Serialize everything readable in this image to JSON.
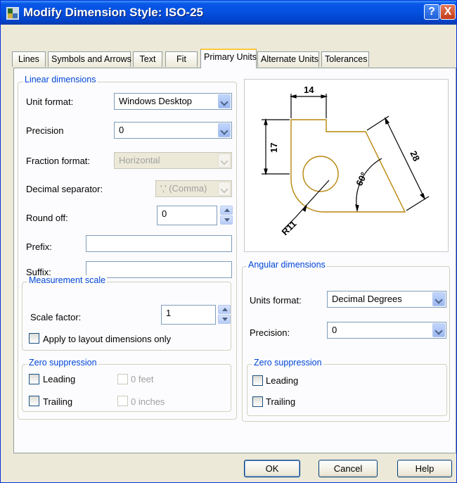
{
  "window": {
    "title": "Modify Dimension Style: ISO-25"
  },
  "titlebar": {
    "help": "?",
    "close": "X"
  },
  "tabs": [
    {
      "label": "Lines"
    },
    {
      "label": "Symbols and Arrows"
    },
    {
      "label": "Text"
    },
    {
      "label": "Fit"
    },
    {
      "label": "Primary Units"
    },
    {
      "label": "Alternate Units"
    },
    {
      "label": "Tolerances"
    }
  ],
  "linear": {
    "title": "Linear dimensions",
    "unit_format": {
      "label": "Unit format:",
      "value": "Windows Desktop"
    },
    "precision": {
      "label": "Precision",
      "value": "0"
    },
    "fraction_format": {
      "label": "Fraction format:",
      "value": "Horizontal"
    },
    "decimal_separator": {
      "label": "Decimal separator:",
      "value": "',' (Comma)"
    },
    "round_off": {
      "label": "Round off:",
      "value": "0"
    },
    "prefix": {
      "label": "Prefix:",
      "value": ""
    },
    "suffix": {
      "label": "Suffix:",
      "value": ""
    }
  },
  "measurement": {
    "title": "Measurement scale",
    "scale_factor": {
      "label": "Scale factor:",
      "value": "1"
    },
    "apply_layout": {
      "label": "Apply to layout dimensions only",
      "checked": false
    }
  },
  "zero_left": {
    "title": "Zero suppression",
    "leading": "Leading",
    "trailing": "Trailing",
    "feet": "0 feet",
    "inches": "0 inches"
  },
  "preview": {
    "dim_top": "14",
    "dim_left": "17",
    "dim_right": "28",
    "dim_angle": "60°",
    "dim_radius": "R11",
    "colors": {
      "geometry": "#b8860b",
      "dims": "#000000"
    }
  },
  "angular": {
    "title": "Angular dimensions",
    "units_format": {
      "label": "Units format:",
      "value": "Decimal Degrees"
    },
    "precision": {
      "label": "Precision:",
      "value": "0"
    }
  },
  "zero_right": {
    "title": "Zero suppression",
    "leading": "Leading",
    "trailing": "Trailing"
  },
  "buttons": {
    "ok": "OK",
    "cancel": "Cancel",
    "help": "Help"
  }
}
